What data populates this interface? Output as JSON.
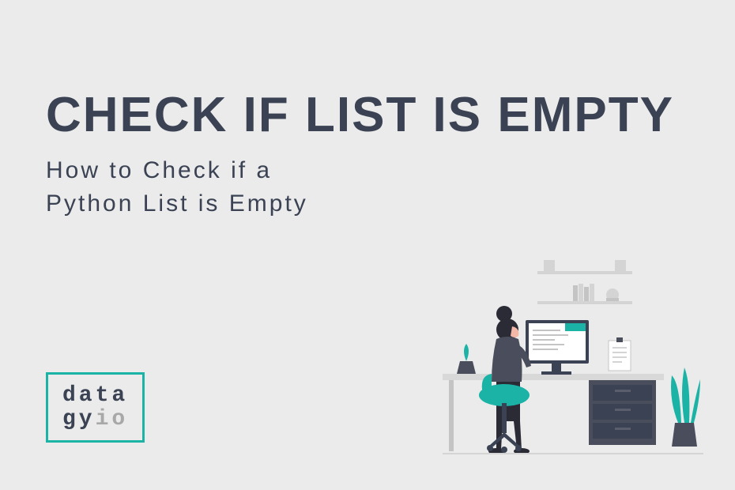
{
  "title": "CHECK IF LIST IS EMPTY",
  "subtitle_line1": "How to Check if a",
  "subtitle_line2": "Python List is Empty",
  "logo": {
    "line1": "data",
    "line2_part1": "gy",
    "line2_part2": "io"
  },
  "colors": {
    "background": "#ebebeb",
    "text_dark": "#3a4253",
    "accent_teal": "#1ab3a6",
    "text_muted": "#a8a8a8"
  }
}
